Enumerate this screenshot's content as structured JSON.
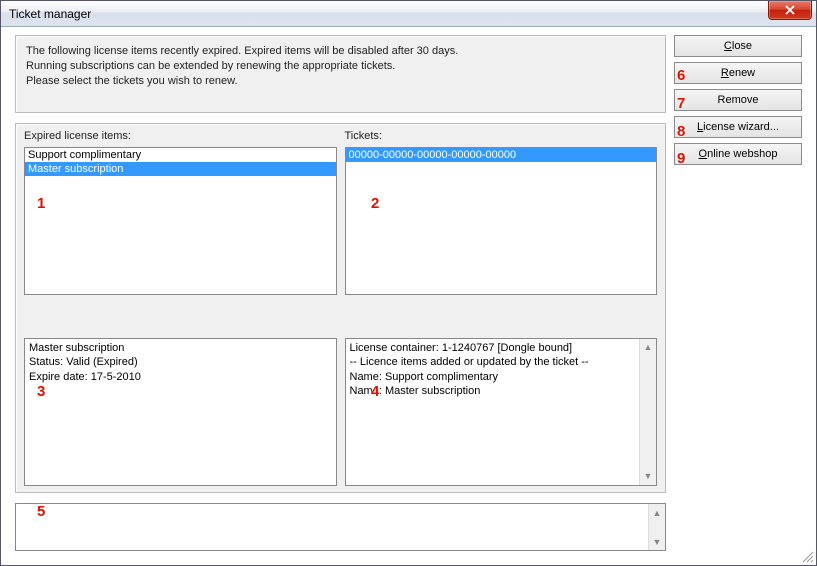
{
  "window": {
    "title": "Ticket manager"
  },
  "info": {
    "line1": "The following license items recently expired. Expired items will be disabled after 30 days.",
    "line2": "Running subscriptions can be extended by renewing the appropriate tickets.",
    "line3": "Please select the tickets you wish to renew."
  },
  "buttons": {
    "close": "Close",
    "renew": "Renew",
    "remove": "Remove",
    "license_wizard": "License wizard...",
    "online_webshop": "Online webshop"
  },
  "labels": {
    "expired_items": "Expired license items:",
    "tickets": "Tickets:"
  },
  "expired_items": [
    {
      "label": "Support complimentary",
      "selected": false
    },
    {
      "label": "Master subscription",
      "selected": true
    }
  ],
  "tickets": [
    {
      "label": "00000-00000-00000-00000-00000",
      "selected": true
    }
  ],
  "item_detail": {
    "line1": "Master subscription",
    "line2": "Status: Valid (Expired)",
    "line3": "Expire date: 17-5-2010"
  },
  "ticket_detail": {
    "line1": "License container: 1-1240767 [Dongle bound]",
    "line2": "-- Licence items added or updated by the ticket --",
    "line3": "Name: Support complimentary",
    "line4": "Name: Master subscription"
  },
  "callouts": {
    "c1": "1",
    "c2": "2",
    "c3": "3",
    "c4": "4",
    "c5": "5",
    "c6": "6",
    "c7": "7",
    "c8": "8",
    "c9": "9"
  }
}
